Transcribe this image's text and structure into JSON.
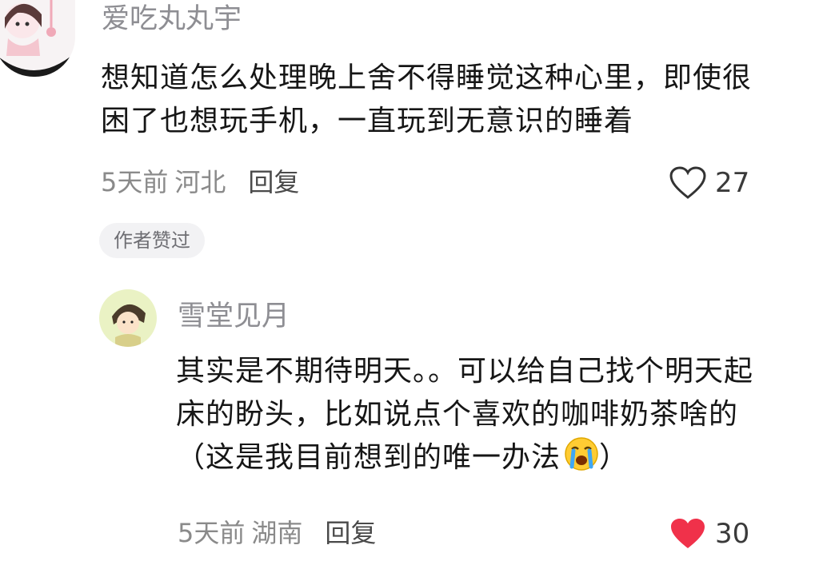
{
  "comments": [
    {
      "username": "爱吃丸丸宇",
      "content_lines": [
        "想知道怎么处理晚上舍不得睡觉这种心里，即使很",
        "困了也想玩手机，一直玩到无意识的睡着"
      ],
      "time": "5天前",
      "location": "河北",
      "reply_label": "回复",
      "likes": "27",
      "liked": false,
      "badge": "作者赞过"
    },
    {
      "username": "雪堂见月",
      "content_lines": [
        "其实是不期待明天。。可以给自己找个明天起",
        "床的盼头，比如说点个喜欢的咖啡奶茶啥的",
        "（这是我目前想到的唯一办法",
        "）"
      ],
      "time": "5天前",
      "location": "湖南",
      "reply_label": "回复",
      "likes": "30",
      "liked": true
    }
  ],
  "colors": {
    "liked_heart": "#f0314a",
    "username": "#8e8e93",
    "badge_bg": "#f2f2f4"
  },
  "icons": {
    "emoji": "loudly-crying-face-emoji",
    "like_outline": "heart-outline-icon",
    "like_filled": "heart-filled-icon"
  }
}
